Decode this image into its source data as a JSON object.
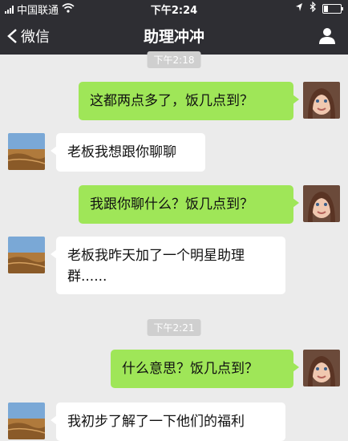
{
  "status_bar": {
    "carrier": "中国联通",
    "time": "下午2:24"
  },
  "nav": {
    "back_label": "微信",
    "title": "助理冲冲"
  },
  "messages": [
    {
      "side": "me",
      "text": "这都两点多了，饭几点到？"
    },
    {
      "side": "other",
      "text": "老板我想跟你聊聊"
    },
    {
      "side": "me",
      "text": "我跟你聊什么？饭几点到？"
    },
    {
      "side": "other",
      "text": "老板我昨天加了一个明星助理群......"
    },
    {
      "side": "me",
      "text": "什么意思？饭几点到？"
    },
    {
      "side": "other",
      "text": "我初步了解了一下他们的福利"
    }
  ],
  "timestamps": [
    "下午2:18",
    "下午2:21"
  ],
  "colors": {
    "nav_bg": "#2e2e33",
    "bubble_me": "#9fe658",
    "bubble_other": "#ffffff",
    "chat_bg": "#ebebeb"
  }
}
